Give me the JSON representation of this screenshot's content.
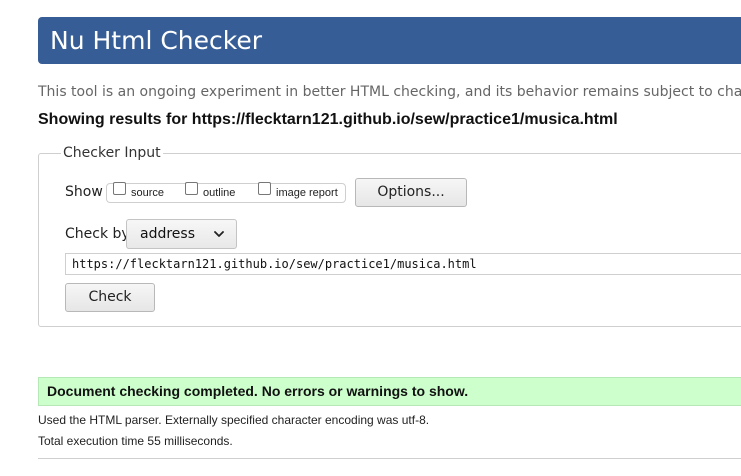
{
  "header": {
    "title": "Nu Html Checker"
  },
  "intro": {
    "text": "This tool is an ongoing experiment in better HTML checking, and its behavior remains subject to change"
  },
  "results": {
    "heading": "Showing results for https://flecktarn121.github.io/sew/practice1/musica.html"
  },
  "checker_input": {
    "legend": "Checker Input",
    "show_label": "Show",
    "options": [
      {
        "label": "source",
        "checked": false
      },
      {
        "label": "outline",
        "checked": false
      },
      {
        "label": "image report",
        "checked": false
      }
    ],
    "options_button": "Options...",
    "check_by_label": "Check by",
    "check_by_selected": "address",
    "url_value": "https://flecktarn121.github.io/sew/practice1/musica.html",
    "check_button": "Check"
  },
  "status": {
    "message": "Document checking completed. No errors or warnings to show.",
    "color": "#ccffcc"
  },
  "details": {
    "parser_line": "Used the HTML parser. Externally specified character encoding was utf-8.",
    "time_line": "Total execution time 55 milliseconds."
  }
}
